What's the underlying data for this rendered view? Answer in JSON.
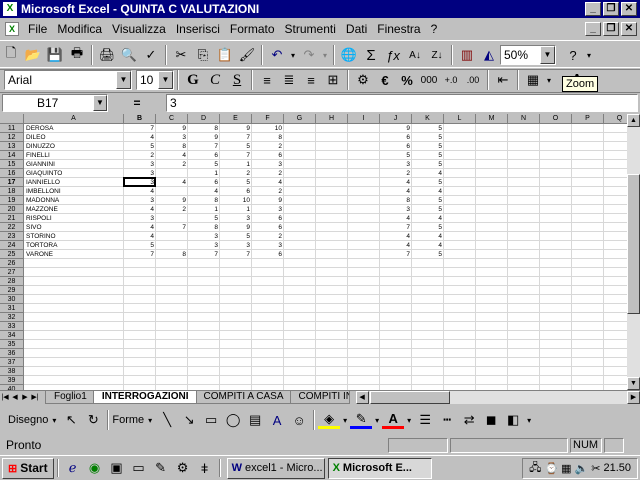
{
  "window": {
    "title": "Microsoft Excel - QUINTA C VALUTAZIONI",
    "app_icon": "excel-icon"
  },
  "menu": [
    "File",
    "Modifica",
    "Visualizza",
    "Inserisci",
    "Formato",
    "Strumenti",
    "Dati",
    "Finestra",
    "?"
  ],
  "toolbar": {
    "zoom": "50%",
    "tooltip": "Zoom"
  },
  "format": {
    "font": "Arial",
    "size": "10",
    "bold": "G",
    "italic": "C",
    "underline": "S",
    "currency": "€",
    "percent": "%",
    "thousands": "000"
  },
  "formula": {
    "cell": "B17",
    "eq": "=",
    "value": "3"
  },
  "grid": {
    "columns": [
      "A",
      "B",
      "C",
      "D",
      "E",
      "F",
      "G",
      "H",
      "I",
      "J",
      "K",
      "L",
      "M",
      "N",
      "O",
      "P",
      "Q"
    ],
    "rows": [
      {
        "n": "11",
        "name": "DEROSA",
        "b": "7",
        "c": "9",
        "d": "8",
        "e": "9",
        "f": "10",
        "j": "9",
        "k": "5"
      },
      {
        "n": "12",
        "name": "DILEO",
        "b": "4",
        "c": "3",
        "d": "9",
        "e": "7",
        "f": "8",
        "j": "6",
        "k": "5"
      },
      {
        "n": "13",
        "name": "DINUZZO",
        "b": "5",
        "c": "8",
        "d": "7",
        "e": "5",
        "f": "2",
        "j": "6",
        "k": "5"
      },
      {
        "n": "14",
        "name": "FINELLI",
        "b": "2",
        "c": "4",
        "d": "6",
        "e": "7",
        "f": "6",
        "j": "5",
        "k": "5"
      },
      {
        "n": "15",
        "name": "GIANNINI",
        "b": "3",
        "c": "2",
        "d": "5",
        "e": "1",
        "f": "3",
        "j": "3",
        "k": "5"
      },
      {
        "n": "16",
        "name": "GIAQUINTO",
        "b": "3",
        "c": "",
        "d": "1",
        "e": "2",
        "f": "2",
        "j": "2",
        "k": "4"
      },
      {
        "n": "17",
        "name": "IANNIELLO",
        "b": "3",
        "c": "4",
        "d": "6",
        "e": "5",
        "f": "4",
        "j": "4",
        "k": "5"
      },
      {
        "n": "18",
        "name": "IMBELLONI",
        "b": "4",
        "c": "",
        "d": "4",
        "e": "6",
        "f": "2",
        "j": "4",
        "k": "4"
      },
      {
        "n": "19",
        "name": "MADONNA",
        "b": "3",
        "c": "9",
        "d": "8",
        "e": "10",
        "f": "9",
        "j": "8",
        "k": "5"
      },
      {
        "n": "20",
        "name": "MAZZONE",
        "b": "4",
        "c": "2",
        "d": "1",
        "e": "1",
        "f": "3",
        "j": "3",
        "k": "5"
      },
      {
        "n": "21",
        "name": "RISPOLI",
        "b": "3",
        "c": "",
        "d": "5",
        "e": "3",
        "f": "6",
        "j": "4",
        "k": "4"
      },
      {
        "n": "22",
        "name": "SIVO",
        "b": "4",
        "c": "7",
        "d": "8",
        "e": "9",
        "f": "6",
        "j": "7",
        "k": "5"
      },
      {
        "n": "23",
        "name": "STORINO",
        "b": "4",
        "c": "",
        "d": "3",
        "e": "5",
        "f": "2",
        "j": "4",
        "k": "4"
      },
      {
        "n": "24",
        "name": "TORTORA",
        "b": "5",
        "c": "",
        "d": "3",
        "e": "3",
        "f": "3",
        "j": "4",
        "k": "4"
      },
      {
        "n": "25",
        "name": "VARONE",
        "b": "7",
        "c": "8",
        "d": "7",
        "e": "7",
        "f": "6",
        "j": "7",
        "k": "5"
      },
      {
        "n": "26"
      },
      {
        "n": "27"
      },
      {
        "n": "28"
      },
      {
        "n": "29"
      },
      {
        "n": "30"
      },
      {
        "n": "31"
      },
      {
        "n": "32"
      },
      {
        "n": "33"
      },
      {
        "n": "34"
      },
      {
        "n": "35"
      },
      {
        "n": "36"
      },
      {
        "n": "37"
      },
      {
        "n": "38"
      },
      {
        "n": "39"
      },
      {
        "n": "40"
      }
    ]
  },
  "sheets": [
    "Foglio1",
    "INTERROGAZIONI",
    "COMPITI A CASA",
    "COMPITI IN C"
  ],
  "drawing": {
    "draw_label": "Disegno",
    "shapes_label": "Forme"
  },
  "status": {
    "text": "Pronto",
    "num": "NUM"
  },
  "taskbar": {
    "start": "Start",
    "tasks": [
      "excel1 - Micro...",
      "Microsoft E..."
    ],
    "clock": "21.50"
  }
}
